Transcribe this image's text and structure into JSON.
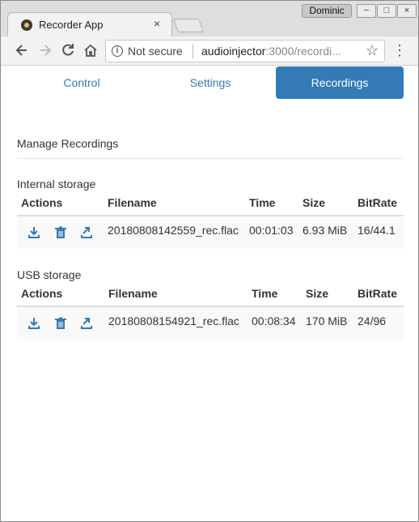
{
  "browser": {
    "tab_title": "Recorder App",
    "tab_close": "×",
    "profile_name": "Dominic",
    "window_buttons": [
      "−",
      "□",
      "×"
    ],
    "not_secure": "Not secure",
    "url_host": "audioinjector",
    "url_rest": ":3000/recordi..."
  },
  "nav": {
    "tabs": [
      {
        "label": "Control"
      },
      {
        "label": "Settings"
      },
      {
        "label": "Recordings"
      }
    ],
    "active_tab": "Recordings",
    "accent_color": "#337ab7"
  },
  "page": {
    "title": "Manage Recordings"
  },
  "storages": [
    {
      "label": "Internal storage",
      "headers": [
        "Actions",
        "Filename",
        "Time",
        "Size",
        "BitRate"
      ],
      "rows": [
        {
          "filename": "20180808142559_rec.flac",
          "time": "00:01:03",
          "size": "6.93 MiB",
          "bitrate": "16/44.1"
        }
      ]
    },
    {
      "label": "USB storage",
      "headers": [
        "Actions",
        "Filename",
        "Time",
        "Size",
        "BitRate"
      ],
      "rows": [
        {
          "filename": "20180808154921_rec.flac",
          "time": "00:08:34",
          "size": "170 MiB",
          "bitrate": "24/96"
        }
      ]
    }
  ],
  "action_icons": [
    "download-icon",
    "trash-icon",
    "export-icon"
  ]
}
